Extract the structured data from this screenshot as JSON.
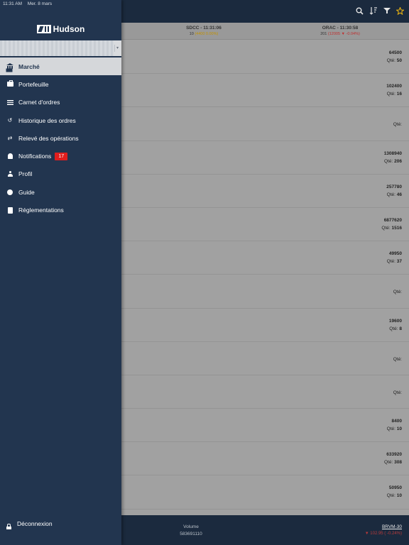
{
  "status_bar": {
    "time": "11:31 AM",
    "date": "Mer. 8 mars"
  },
  "brand": {
    "name": "Hudson"
  },
  "topbar": {
    "icons": [
      "search-icon",
      "sort-icon",
      "filter-icon",
      "star-icon"
    ]
  },
  "tickers": [
    {
      "name": "SDCC - 11:31:06",
      "qty": "10",
      "change": "(4400 0.00%)",
      "trend": "neutral"
    },
    {
      "name": "ORAC - 11:30:58",
      "qty": "201",
      "change": "(12005 ▼ -0.04%)",
      "trend": "down"
    }
  ],
  "rows": [
    {
      "price": "64500",
      "qty_label": "Qté:",
      "qty": "50"
    },
    {
      "price": "102400",
      "qty_label": "Qté:",
      "qty": "16"
    },
    {
      "price": "",
      "qty_label": "Qté:",
      "qty": ""
    },
    {
      "price": "1308940",
      "qty_label": "Qté:",
      "qty": "206"
    },
    {
      "price": "257780",
      "qty_label": "Qté:",
      "qty": "46"
    },
    {
      "price": "6877620",
      "qty_label": "Qté:",
      "qty": "1516"
    },
    {
      "price": "49950",
      "qty_label": "Qté:",
      "qty": "37"
    },
    {
      "price": "",
      "qty_label": "Qté:",
      "qty": ""
    },
    {
      "price": "19600",
      "qty_label": "Qté:",
      "qty": "8"
    },
    {
      "price": "",
      "qty_label": "Qté:",
      "qty": ""
    },
    {
      "price": "",
      "qty_label": "Qté:",
      "qty": ""
    },
    {
      "price": "8400",
      "qty_label": "Qté:",
      "qty": "10"
    },
    {
      "price": "633920",
      "qty_label": "Qté:",
      "qty": "308"
    },
    {
      "price": "50950",
      "qty_label": "Qté:",
      "qty": "10"
    }
  ],
  "bottombar": {
    "volume_label": "Volume",
    "volume_value": "583691110",
    "index_name": "BRVM-30",
    "index_value": "▼ 102.95 ( -0.24%)"
  },
  "drawer": {
    "menu": [
      {
        "label": "Marché",
        "icon": "bank-icon",
        "active": true
      },
      {
        "label": "Portefeuille",
        "icon": "briefcase-icon"
      },
      {
        "label": "Carnet d'ordres",
        "icon": "order-book-icon"
      },
      {
        "label": "Historique des ordres",
        "icon": "history-icon"
      },
      {
        "label": "Relevé des opérations",
        "icon": "transfer-icon"
      },
      {
        "label": "Notifications",
        "icon": "bell-icon",
        "badge": "17"
      },
      {
        "label": "Profil",
        "icon": "user-icon"
      },
      {
        "label": "Guide",
        "icon": "info-icon"
      },
      {
        "label": "Réglementations",
        "icon": "document-icon"
      }
    ],
    "logout_label": "Déconnexion"
  },
  "colors": {
    "drawer_bg": "#22354f",
    "bar_bg": "#1b2a3e",
    "badge": "#e01e1e",
    "favorite": "#f2b80f",
    "negative": "#c03030"
  }
}
